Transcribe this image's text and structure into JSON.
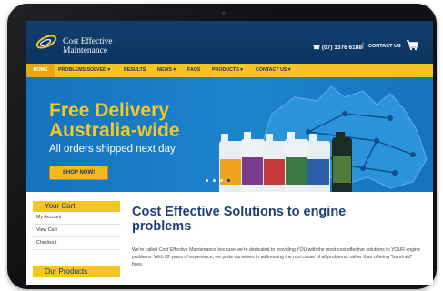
{
  "site": {
    "brand_line1": "Cost Effective",
    "brand_line2": "Maintenance",
    "phone": "☎ (07) 3376 6188",
    "separator": "|",
    "contact_label": "CONTACT US"
  },
  "nav": {
    "items": [
      "HOME",
      "PROBLEMS SOLVED ▾",
      "RESULTS",
      "NEWS ▾",
      "FAQS",
      "PRODUCTS ▾",
      "CONTACT US ▾"
    ]
  },
  "banner": {
    "headline1": "Free Delivery",
    "headline2": "Australia-wide",
    "subline": "All orders shipped next day.",
    "cta": "SHOP NOW!",
    "slides": 4,
    "active_slide": 3
  },
  "sidebar": {
    "cart_title": "Your Cart",
    "items": [
      "My Account",
      "View Cart",
      "Checkout"
    ],
    "products_title": "Our Products"
  },
  "main": {
    "title": "Cost Effective Solutions to engine problems",
    "paragraph": "We're called Cost Effective Maintenance because we're dedicated to providing YOU with the most cost effective solutions to YOUR engine problems. With 32 years of experience, we pride ourselves in addressing the root cause of all problems, rather than offering \"band-aid\" fixes."
  },
  "colors": {
    "header_navy": "#123f6e",
    "nav_yellow": "#f5c623",
    "banner_blue": "#1d84ce",
    "accent_gold": "#f6c723"
  }
}
